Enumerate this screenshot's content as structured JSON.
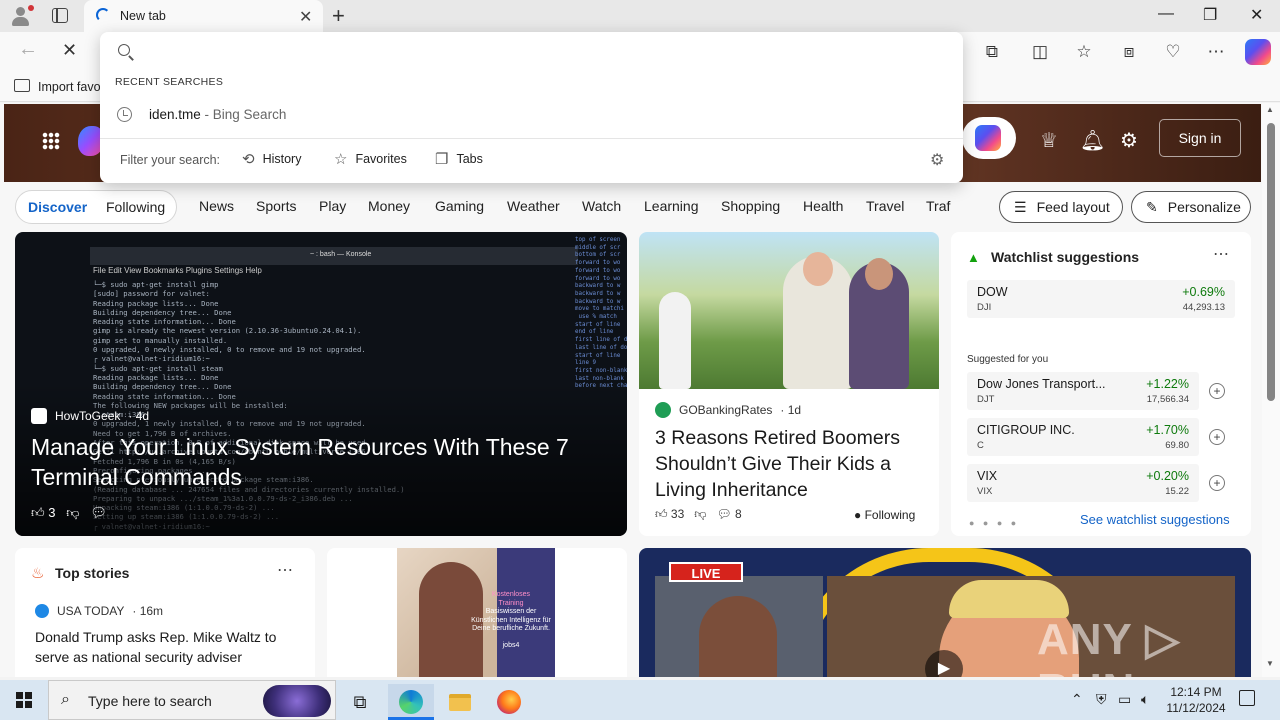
{
  "browser": {
    "tab_title": "New tab",
    "new_tab_glyph": "+",
    "window": {
      "minimize": "—",
      "restore": "❐",
      "close": "✕"
    },
    "favorites_bar": {
      "import_label": "Import favo"
    }
  },
  "omnibox": {
    "placeholder": "",
    "recent_label": "RECENT SEARCHES",
    "suggestion": {
      "term": "iden.tme",
      "source": " - Bing Search"
    },
    "filter_label": "Filter your search:",
    "filters": [
      "History",
      "Favorites",
      "Tabs"
    ]
  },
  "msn": {
    "signin": "Sign in",
    "discover": "Discover",
    "following": "Following",
    "nav": [
      "News",
      "Sports",
      "Play",
      "Money",
      "Gaming",
      "Weather",
      "Watch",
      "Learning",
      "Shopping",
      "Health",
      "Travel",
      "Traf"
    ],
    "feed_layout": "Feed layout",
    "personalize": "Personalize"
  },
  "cards": {
    "linux": {
      "source": "HowToGeek",
      "age": "· 4d",
      "title": "Manage Your Linux System Resources With These 7 Terminal Commands",
      "likes": "3",
      "terminal_title": "~ : bash — Konsole",
      "terminal_menu": "File  Edit  View  Bookmarks  Plugins  Settings  Help",
      "terminal_text": "└─$ sudo apt-get install gimp\n[sudo] password for valnet:\nReading package lists... Done\nBuilding dependency tree... Done\nReading state information... Done\ngimp is already the newest version (2.10.36-3ubuntu0.24.04.1).\ngimp set to manually installed.\n0 upgraded, 0 newly installed, 0 to remove and 19 not upgraded.\n┌ valnet@valnet-iridium16:~\n└─$ sudo apt-get install steam\nReading package lists... Done\nBuilding dependency tree... Done\nReading state information... Done\nThe following NEW packages will be installed:\n  steam:i386\n0 upgraded, 1 newly installed, 0 to remove and 19 not upgraded.\nNeed to get 1,796 B of archives.\nAfter this operation, 0 B of additional disk space will be used.\nGet:1 http://us.archive.ubuntu.com/ubuntu noble/multiverse i386\nFetched 1,796 B in 0s (4,165 B/s)\nPreconfiguring packages ...\nSelecting previously unselected package steam:i386.\n(Reading database ... 247654 files and directories currently installed.)\nPreparing to unpack .../steam_1%3a1.0.0.79-ds-2_i386.deb ...\nUnpacking steam:i386 (1:1.0.0.79-ds-2) ...\nSetting up steam:i386 (1:1.0.0.79-ds-2) ...\n┌ valnet@valnet-iridium16:~",
      "terminal_side": "top of screen\nmiddle of scr\nbottom of scr\nforward to wo\nforward to wo\nforward to wo\nbackward to w\nbackward to w\nbackward to w\nmove to matchi\n use % match\nstart of line\nend of line\nfirst line of do\nlast line of doc\nstart of line\nline 9\nfirst non-blank\nlast non-blank\nbefore next char"
    },
    "boomers": {
      "source": "GOBankingRates",
      "age": "· 1d",
      "title": "3 Reasons Retired Boomers Shouldn’t Give Their Kids a Living Inheritance",
      "likes": "33",
      "comments": "8",
      "following": "Following"
    },
    "watchlist": {
      "title": "Watchlist suggestions",
      "top": {
        "name": "DOW",
        "symbol": "DJI",
        "change": "+0.69%",
        "value": "44,293.13"
      },
      "suggested_label": "Suggested for you",
      "items": [
        {
          "name": "Dow Jones Transport...",
          "symbol": "DJT",
          "change": "+1.22%",
          "value": "17,566.34"
        },
        {
          "name": "CITIGROUP INC.",
          "symbol": "C",
          "change": "+1.70%",
          "value": "69.80"
        },
        {
          "name": "VIX",
          "symbol": "VIX",
          "change": "+0.20%",
          "value": "15.22"
        }
      ],
      "see_more": "See watchlist suggestions"
    },
    "top_stories": {
      "title": "Top stories",
      "source": "USA TODAY",
      "age": "· 16m",
      "headline": "Donald Trump asks Rep. Mike Waltz to serve as national security adviser"
    },
    "ad": {
      "text_pre": "Kostenloses",
      "text_hl": "Training",
      "text_body": "Basiswissen der Künstlichen Intelligenz für Deine berufliche Zukunft.",
      "brand": "jobs4"
    },
    "live": {
      "tag": "LIVE",
      "watermark": "ANY ▷ RUN"
    }
  },
  "taskbar": {
    "search_placeholder": "Type here to search",
    "time": "12:14 PM",
    "date": "11/12/2024"
  }
}
